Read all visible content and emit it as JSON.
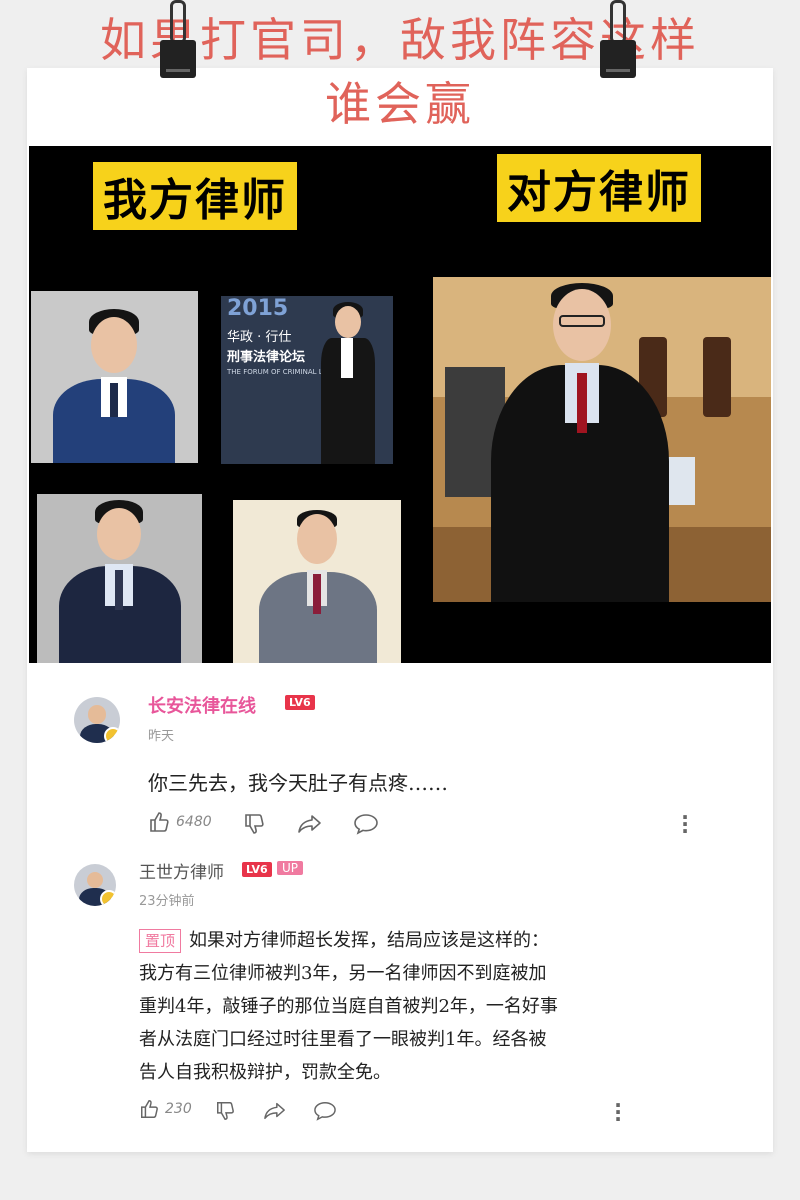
{
  "title_line1": "如果打官司，敌我阵容这样",
  "title_line2": "谁会赢",
  "photo": {
    "left_label": "我方律师",
    "right_label": "对方律师",
    "forum_banner": {
      "year": "2015",
      "line1": "华政 · 行仕",
      "line2": "刑事法律论坛",
      "line3": "THE FORUM OF CRIMINAL LAW"
    }
  },
  "comments": [
    {
      "user": "长安法律在线",
      "level": "LV6",
      "time": "昨天",
      "text": "你三先去，我今天肚子有点疼……",
      "likes": "6480"
    },
    {
      "user": "王世方律师",
      "level": "LV6",
      "up_badge": "UP",
      "time": "23分钟前",
      "pinned_label": "置顶",
      "text_lines": [
        "如果对方律师超长发挥，结局应该是这样的：",
        "我方有三位律师被判3年，另一名律师因不到庭被加",
        "重判4年，敲锤子的那位当庭自首被判2年，一名好事",
        "者从法庭门口经过时往里看了一眼被判1年。经各被",
        "告人自我积极辩护，罚款全免。"
      ],
      "likes": "230"
    }
  ],
  "icons": [
    "like-icon",
    "dislike-icon",
    "share-icon",
    "reply-icon",
    "more-icon"
  ],
  "colors": {
    "title": "#e0635a",
    "username": "#e8569a",
    "level": "#e8344a",
    "badge": "#f7d21b"
  }
}
